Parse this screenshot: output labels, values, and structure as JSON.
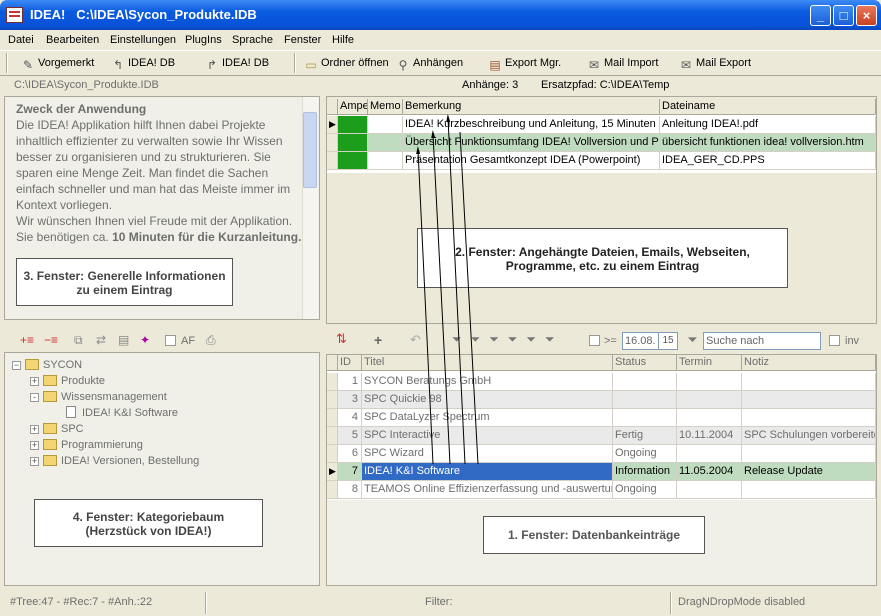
{
  "window": {
    "app": "IDEA!",
    "path": "C:\\IDEA\\Sycon_Produkte.IDB",
    "controls": {
      "minimize": "_",
      "maximize": "□",
      "close": "×"
    }
  },
  "menu": [
    "Datei",
    "Bearbeiten",
    "Einstellungen",
    "PlugIns",
    "Sprache",
    "Fenster",
    "Hilfe"
  ],
  "toolbar": {
    "vorgemerkt": "Vorgemerkt",
    "idea_db_1": "IDEA! DB",
    "idea_db_2": "IDEA! DB",
    "ordner_oeffnen": "Ordner öffnen",
    "anhaengen": "Anhängen",
    "export_mgr": "Export Mgr.",
    "mail_import": "Mail Import",
    "mail_export": "Mail Export"
  },
  "infobar": {
    "db_path": "C:\\IDEA\\Sycon_Produkte.IDB",
    "anhaenge": "Anhänge: 3",
    "ersatzpfad": "Ersatzpfad: C:\\IDEA\\Temp"
  },
  "info_panel": {
    "heading": "Zweck der Anwendung",
    "body": "Die IDEA! Applikation hilft Ihnen dabei Projekte inhaltlich effizienter zu verwalten sowie Ihr Wissen besser zu organisieren und zu strukturieren. Sie sparen eine Menge Zeit. Man findet die Sachen einfach schneller und man hat das Meiste immer im Kontext vorliegen.",
    "wish": "Wir wünschen Ihnen viel Freude mit der Applikation.",
    "time_prefix": "Sie benötigen ca. ",
    "time_bold": "10 Minuten für die Kurzanleitung."
  },
  "attachments": {
    "columns": [
      "Ampel",
      "Memo",
      "Bemerkung",
      "Dateiname"
    ],
    "rows": [
      {
        "bemerkung": "IDEA! Kurzbeschreibung und Anleitung, 15 Minuten",
        "dateiname": "Anleitung IDEA!.pdf",
        "current": true
      },
      {
        "bemerkung": "Übersicht Funktionsumfang IDEA! Vollversion und Pre",
        "dateiname": "übersicht funktionen idea! vollversion.htm",
        "current": false
      },
      {
        "bemerkung": "Präsentation Gesamtkonzept IDEA (Powerpoint)",
        "dateiname": "IDEA_GER_CD.PPS",
        "current": false
      }
    ]
  },
  "annotations": {
    "fenster1": "1. Fenster:  Datenbankeinträge",
    "fenster2_line1": "2. Fenster: Angehängte Dateien, Emails, Webseiten,",
    "fenster2_line2": "Programme, etc.  zu einem Eintrag",
    "fenster3_line1": "3. Fenster: Generelle Informationen",
    "fenster3_line2": "zu einem Eintrag",
    "fenster4_line1": "4. Fenster: Kategoriebaum",
    "fenster4_line2": "(Herzstück von IDEA!)"
  },
  "tree_toolbar": {
    "af_label": "AF"
  },
  "tree": {
    "root": "SYCON",
    "items": [
      {
        "label": "Produkte",
        "level": 1,
        "expander": "+"
      },
      {
        "label": "Wissensmanagement",
        "level": 1,
        "expander": "-"
      },
      {
        "label": "IDEA! K&I Software",
        "level": 2,
        "expander": ""
      },
      {
        "label": "SPC",
        "level": 1,
        "expander": "+"
      },
      {
        "label": "Programmierung",
        "level": 1,
        "expander": "+"
      },
      {
        "label": "IDEA! Versionen, Bestellung",
        "level": 1,
        "expander": "+"
      }
    ]
  },
  "records_toolbar": {
    "date_op": ">=",
    "date_value": "16.08.",
    "date_btn": "15",
    "search_placeholder": "Suche nach",
    "inv_label": "inv"
  },
  "records": {
    "columns": [
      "ID",
      "Titel",
      "Status",
      "Termin",
      "Notiz"
    ],
    "rows": [
      {
        "id": "1",
        "titel": "SYCON Beratungs GmbH",
        "status": "",
        "termin": "",
        "notiz": "",
        "style": "white"
      },
      {
        "id": "3",
        "titel": "SPC Quickie 98",
        "status": "",
        "termin": "",
        "notiz": "",
        "style": "gray"
      },
      {
        "id": "4",
        "titel": "SPC DataLyzer Spectrum",
        "status": "",
        "termin": "",
        "notiz": "",
        "style": "white"
      },
      {
        "id": "5",
        "titel": "SPC Interactive",
        "status": "Fertig",
        "termin": "10.11.2004",
        "notiz": "SPC Schulungen vorbereiten",
        "style": "gray"
      },
      {
        "id": "6",
        "titel": "SPC Wizard",
        "status": "Ongoing",
        "termin": "",
        "notiz": "",
        "style": "white"
      },
      {
        "id": "7",
        "titel": "IDEA! K&I Software",
        "status": "Information",
        "termin": "11.05.2004",
        "notiz": "Release Update",
        "style": "selected"
      },
      {
        "id": "8",
        "titel": "TEAMOS Online Effizienzerfassung und -auswertung",
        "status": "Ongoing",
        "termin": "",
        "notiz": "",
        "style": "white"
      }
    ]
  },
  "statusbar": {
    "counts": "#Tree:47 - #Rec:7 - #Anh.:22",
    "filter": "Filter:",
    "dragdrop": "DragNDropMode disabled"
  },
  "colors": {
    "selection": "#316ac5",
    "ampel_green": "#1c9e1c",
    "highlight_row": "#c0dcc0",
    "title_blue": "#0a5ae0"
  }
}
